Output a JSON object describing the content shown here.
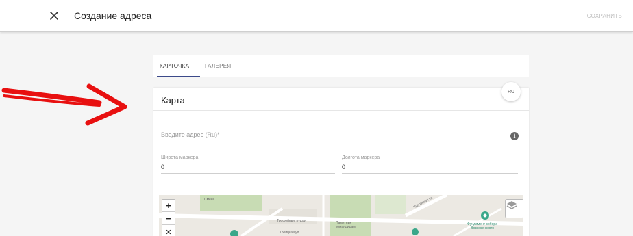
{
  "header": {
    "title": "Создание адреса",
    "save_label": "СОХРАНИТЬ"
  },
  "tabs": [
    {
      "label": "КАРТОЧКА",
      "active": true
    },
    {
      "label": "ГАЛЕРЕЯ",
      "active": false
    }
  ],
  "card": {
    "title": "Карта",
    "lang_label": "RU",
    "address": {
      "placeholder": "Введите адрес (Ru)*",
      "value": ""
    },
    "latitude": {
      "label": "Широта маркера",
      "value": "0"
    },
    "longitude": {
      "label": "Долгота маркера",
      "value": "0"
    }
  },
  "map": {
    "labels": [
      "Смена",
      "Трофейные пушки",
      "Памятник командирам",
      "Троицкая ул.",
      "Чудовская ул.",
      "Фундамент собора Вознесенского"
    ],
    "zoom_in": "+",
    "zoom_out": "−",
    "reset": "✕"
  },
  "colors": {
    "accent": "#3c4a8a",
    "arrow": "#e81010",
    "park": "#c8dcb4",
    "road": "#ffffff"
  },
  "icons": [
    "close-icon",
    "info-icon",
    "layers-icon",
    "arrow-annotation-icon"
  ]
}
